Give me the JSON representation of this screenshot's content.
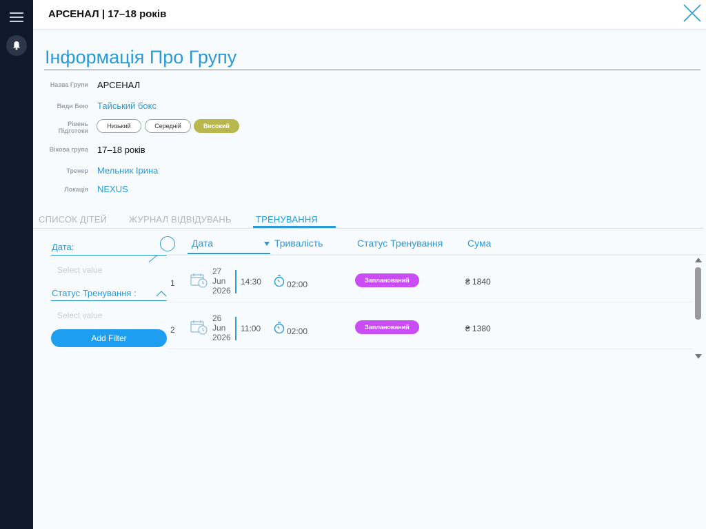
{
  "header": {
    "title": "АРСЕНАЛ | 17–18 років"
  },
  "section": {
    "title": "Інформація Про Групу"
  },
  "info": {
    "group_name": {
      "label": "Назва Групи",
      "value": "АРСЕНАЛ"
    },
    "fight_types": {
      "label": "Види Бою",
      "value": "Тайський бокс"
    },
    "level": {
      "label_line1": "Рівень",
      "label_line2": "Підготоки",
      "options": [
        "Низький",
        "Середній",
        "Високий"
      ],
      "selected": "Високий"
    },
    "age_group": {
      "label": "Вікова група",
      "value": "17–18 років"
    },
    "trainer": {
      "label": "Тренер",
      "value": "Мельник Ірина"
    },
    "location": {
      "label": "Локація",
      "value": "NEXUS"
    }
  },
  "tabs": [
    {
      "label": "СПИСОК ДІТЕЙ",
      "active": false
    },
    {
      "label": "ЖУРНАЛ ВІДВІДУВАНЬ",
      "active": false
    },
    {
      "label": "ТРЕНУВАННЯ",
      "active": true
    }
  ],
  "filters": {
    "date_label": "Дата:",
    "date_placeholder": "Select value",
    "status_label": "Статус Тренування :",
    "status_placeholder": "Select value",
    "add_filter": "Add Filter"
  },
  "table": {
    "columns": [
      "Дата",
      "Тривалість",
      "Статус Тренування",
      "Сума"
    ],
    "rows": [
      {
        "num": "1",
        "day": "27",
        "month": "Jun",
        "year": "2026",
        "time": "14:30",
        "duration": "02:00",
        "status": "Запланований",
        "sum": "₴ 1840"
      },
      {
        "num": "2",
        "day": "26",
        "month": "Jun",
        "year": "2026",
        "time": "11:00",
        "duration": "02:00",
        "status": "Запланований",
        "sum": "₴ 1380"
      }
    ]
  },
  "colors": {
    "accent": "#2a9bd6",
    "sidebar": "#0e1a2b",
    "level_active": "#b9b84f",
    "status_scheduled": "#c94cf5",
    "add_filter_button": "#1e9ef0"
  },
  "icons": [
    "menu-icon",
    "bell-icon",
    "close-icon",
    "search-icon",
    "chevron-up-icon",
    "calendar-icon",
    "stopwatch-icon",
    "sort-down-icon"
  ]
}
